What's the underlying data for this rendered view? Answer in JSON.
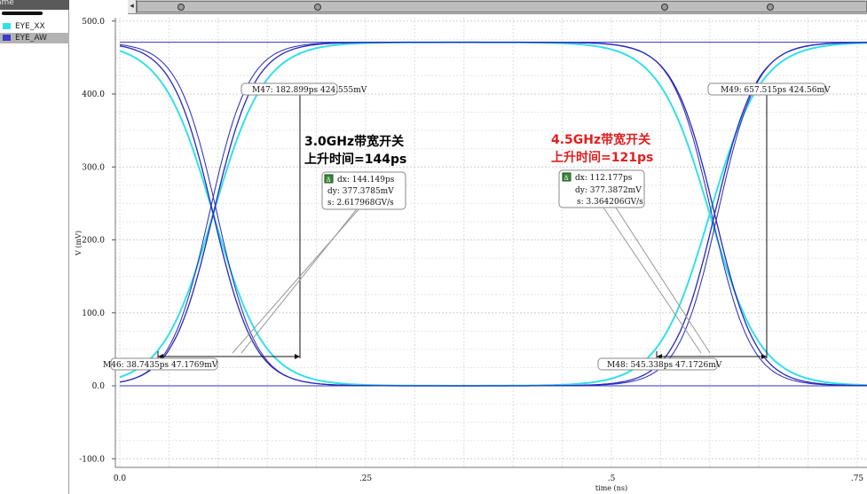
{
  "sidebar": {
    "header_label": "ame",
    "signals": [
      {
        "name": "EYE_XX",
        "color": "#33e0e8"
      },
      {
        "name": "EYE_AW",
        "color": "#3a3acb"
      }
    ]
  },
  "chart_data": {
    "type": "line",
    "xlabel": "time (ns)",
    "ylabel": "V (mV)",
    "xlim": [
      0,
      0.765
    ],
    "ylim": [
      -100,
      500
    ],
    "x_ticks": [
      "0.0",
      ".25",
      ".5",
      ".75"
    ],
    "y_ticks": [
      "500.0",
      "400.0",
      "300.0",
      "200.0",
      "100.0",
      "0.0",
      "-100.0"
    ],
    "grid": true,
    "series": [
      {
        "name": "EYE_XX",
        "color": "#33e0e8",
        "rise_time_ps": 144,
        "transitions_at_ns": [
          0.095,
          0.595
        ]
      },
      {
        "name": "EYE_AW",
        "color": "#2828b8",
        "rise_time_ps": 121,
        "transitions_at_ns": [
          0.095,
          0.605
        ]
      }
    ],
    "markers": [
      {
        "label": "M47: 182.899ps 424.555mV",
        "x": 0.183,
        "y": 424.6
      },
      {
        "label": "M49: 657.515ps 424.56mV",
        "x": 0.6575,
        "y": 424.6
      },
      {
        "label": "M46: 38.7435ps 47.1769mV",
        "x": 0.0387,
        "y": 47.2
      },
      {
        "label": "M48: 545.338ps 47.1726mV",
        "x": 0.5453,
        "y": 47.2
      }
    ],
    "deltas": [
      {
        "dx": "dx: 144.149ps",
        "dy": "dy: 377.3785mV",
        "s": "s: 2.617968GV/s"
      },
      {
        "dx": "dx: 112.177ps",
        "dy": "dy: 377.3872mV",
        "s": "s: 3.364206GV/s"
      }
    ],
    "annotations": [
      {
        "line1": "3.0GHz带宽开关",
        "line2": "上升时间=144ps",
        "color": "#000000"
      },
      {
        "line1": "4.5GHz带宽开关",
        "line2": "上升时间=121ps",
        "color": "#e02020"
      }
    ]
  }
}
